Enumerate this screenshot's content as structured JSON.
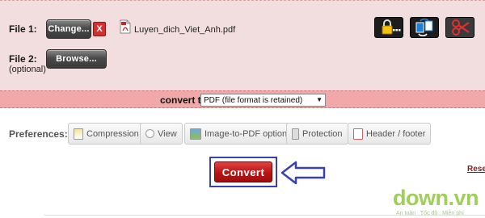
{
  "file1": {
    "label": "File 1:",
    "change_label": "Change...",
    "remove_glyph": "X",
    "file_name": "Luyen_dich_Viet_Anh.pdf"
  },
  "file2": {
    "label": "File 2:",
    "sublabel": "(optional)",
    "browse_label": "Browse..."
  },
  "tool_icons": [
    "lock-icon",
    "document-swap-icon",
    "scissors-icon"
  ],
  "convert_bar": {
    "label": "convert to",
    "selected_format": "PDF (file format is retained)"
  },
  "preferences": {
    "label": "Preferences:",
    "buttons": [
      {
        "label": "Compression",
        "icon": "compression-icon"
      },
      {
        "label": "View",
        "icon": "view-icon"
      },
      {
        "label": "Image-to-PDF options",
        "icon": "image-icon"
      },
      {
        "label": "Protection",
        "icon": "protection-icon"
      },
      {
        "label": "Header / footer",
        "icon": "header-footer-icon"
      }
    ]
  },
  "convert_button": "Convert",
  "reset_link": "Reset",
  "watermark": {
    "logo": "down.vn",
    "tagline": "An toàn . Tốc độ . Miễn phí"
  },
  "colors": {
    "panel_bg": "#f2dede",
    "convert_bar_bg": "#f0a8a8",
    "convert_button": "#c01818",
    "highlight_frame": "#3a40b0",
    "watermark_green": "#9fcf5a"
  }
}
